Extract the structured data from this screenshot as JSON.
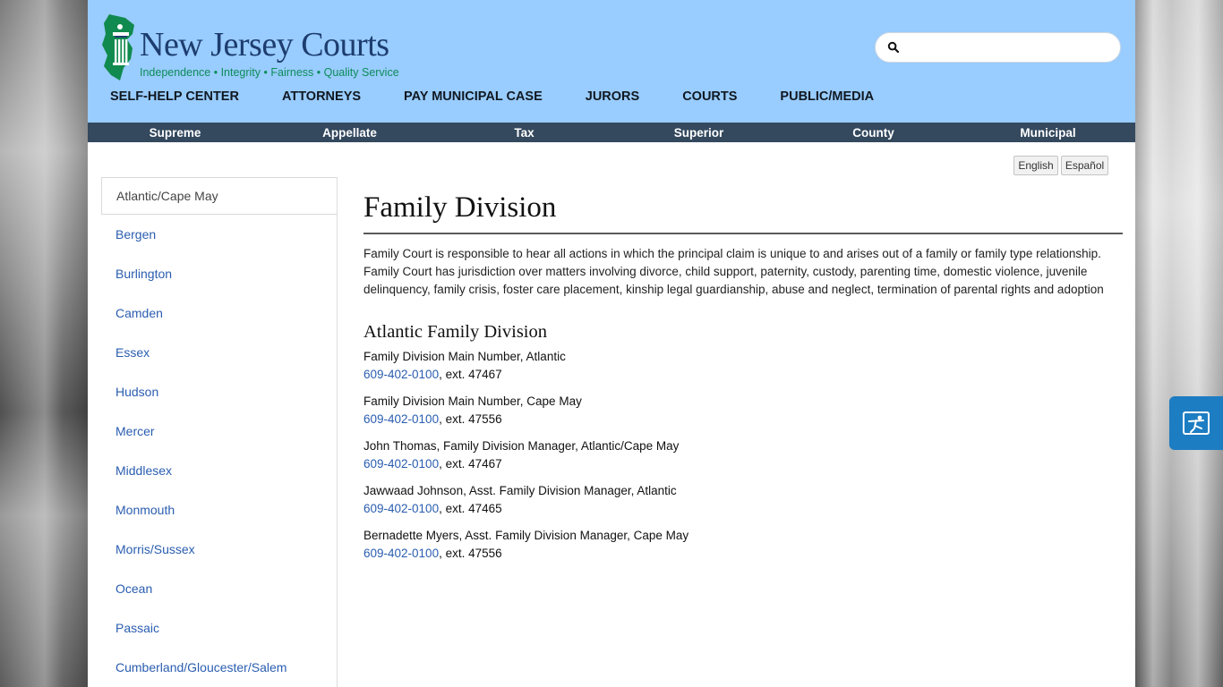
{
  "logo": {
    "title": "New Jersey Courts",
    "tagline": "Independence • Integrity • Fairness • Quality Service"
  },
  "search": {
    "placeholder": "",
    "value": ""
  },
  "main_nav": [
    {
      "label": "SELF-HELP CENTER"
    },
    {
      "label": "ATTORNEYS"
    },
    {
      "label": "PAY MUNICIPAL CASE"
    },
    {
      "label": "JURORS"
    },
    {
      "label": "COURTS"
    },
    {
      "label": "PUBLIC/MEDIA"
    }
  ],
  "court_nav": [
    {
      "label": "Supreme"
    },
    {
      "label": "Appellate"
    },
    {
      "label": "Tax"
    },
    {
      "label": "Superior"
    },
    {
      "label": "County"
    },
    {
      "label": "Municipal"
    }
  ],
  "language": {
    "english": "English",
    "spanish": "Español"
  },
  "sidebar": {
    "items": [
      {
        "label": "Atlantic/Cape May",
        "active": true
      },
      {
        "label": "Bergen"
      },
      {
        "label": "Burlington"
      },
      {
        "label": "Camden"
      },
      {
        "label": "Essex"
      },
      {
        "label": "Hudson"
      },
      {
        "label": "Mercer"
      },
      {
        "label": "Middlesex"
      },
      {
        "label": "Monmouth"
      },
      {
        "label": "Morris/Sussex"
      },
      {
        "label": "Ocean"
      },
      {
        "label": "Passaic"
      },
      {
        "label": "Cumberland/Gloucester/Salem"
      }
    ]
  },
  "content": {
    "title": "Family Division",
    "intro": "Family Court is responsible to hear all actions in which the principal claim is unique to and arises out of a family or family type relationship. Family Court has jurisdiction over matters involving divorce, child support, paternity, custody, parenting time, domestic violence, juvenile delinquency, family crisis, foster care placement, kinship legal guardianship, abuse and neglect, termination of parental rights and adoption",
    "section_title": "Atlantic Family Division",
    "contacts": [
      {
        "name": "Family Division Main Number, Atlantic",
        "phone": "609-402-0100",
        "ext": ", ext. 47467"
      },
      {
        "name": "Family Division Main Number, Cape May",
        "phone": "609-402-0100",
        "ext": ", ext. 47556"
      },
      {
        "name": "John Thomas, Family Division Manager, Atlantic/Cape May",
        "phone": "609-402-0100",
        "ext": ", ext. 47467"
      },
      {
        "name": "Jawwaad Johnson, Asst. Family Division Manager, Atlantic",
        "phone": "609-402-0100",
        "ext": ", ext. 47465"
      },
      {
        "name": "Bernadette Myers, Asst. Family Division Manager, Cape May",
        "phone": "609-402-0100",
        "ext": ", ext. 47556"
      }
    ]
  },
  "accessibility_widget": {
    "icon": "accessibility-icon"
  },
  "colors": {
    "header_bg": "#99ccff",
    "court_bar_bg": "#34495e",
    "link": "#2a5db0",
    "logo_title": "#1d3d6e",
    "logo_tagline": "#0d8c58",
    "accessibility_button": "#1d7dc2"
  }
}
